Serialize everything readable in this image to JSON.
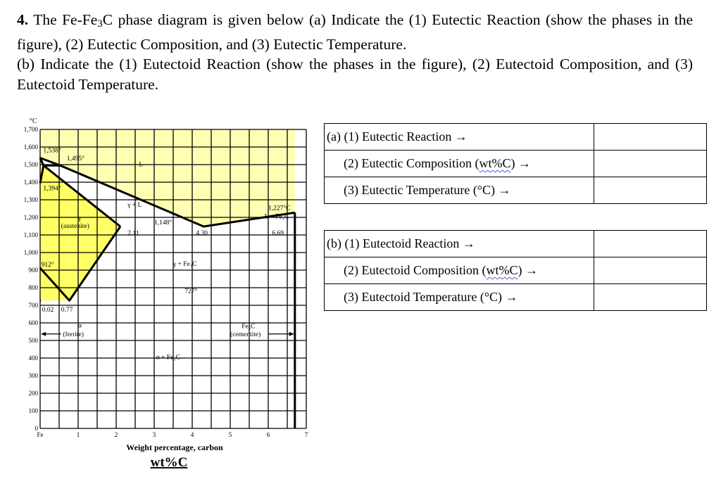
{
  "question": {
    "number": "4.",
    "part_a_text_1": " The Fe-Fe",
    "part_a_sub": "3",
    "part_a_text_2": "C phase diagram is given below (a) Indicate the (1) Eutectic Reaction (show the phases in the figure), (2) Eutectic Composition, and (3) Eutectic Temperature.",
    "part_b_text": "(b) Indicate the (1) Eutectoid Reaction (show the phases in the figure), (2) Eutectoid Composition, and (3) Eutectoid Temperature."
  },
  "table_a": {
    "rows": [
      {
        "label": "(a) (1) Eutectic Reaction →",
        "answer": ""
      },
      {
        "label_pre": "(2) Eutectic Composition (",
        "label_squig": "wt%C",
        "label_post": ") →",
        "answer": ""
      },
      {
        "label": "(3) Eutectic Temperature (°C) →",
        "answer": ""
      }
    ]
  },
  "table_b": {
    "rows": [
      {
        "label": "(b) (1) Eutectoid Reaction →",
        "answer": ""
      },
      {
        "label_pre": "(2) Eutectoid Composition (",
        "label_squig": "wt%C",
        "label_post": ") →",
        "answer": ""
      },
      {
        "label": "(3) Eutectoid Temperature (°C) →",
        "answer": ""
      }
    ]
  },
  "chart_data": {
    "type": "line",
    "title": "Fe-Fe3C phase diagram",
    "xlabel": "Weight percentage, carbon",
    "xlabel_units": "wt%C",
    "ylabel": "°C",
    "xlim": [
      0,
      7
    ],
    "ylim": [
      0,
      1700
    ],
    "grid": true,
    "x_ticks": [
      {
        "v": 0,
        "label": "Fe"
      },
      {
        "v": 1,
        "label": "1"
      },
      {
        "v": 2,
        "label": "2"
      },
      {
        "v": 3,
        "label": "3"
      },
      {
        "v": 4,
        "label": "4"
      },
      {
        "v": 5,
        "label": "5"
      },
      {
        "v": 6,
        "label": "6"
      },
      {
        "v": 7,
        "label": "7"
      }
    ],
    "y_ticks": [
      {
        "v": 0,
        "label": "0"
      },
      {
        "v": 100,
        "label": "100"
      },
      {
        "v": 200,
        "label": "200"
      },
      {
        "v": 300,
        "label": "300"
      },
      {
        "v": 400,
        "label": "400"
      },
      {
        "v": 500,
        "label": "500"
      },
      {
        "v": 600,
        "label": "600"
      },
      {
        "v": 700,
        "label": "700"
      },
      {
        "v": 800,
        "label": "800"
      },
      {
        "v": 900,
        "label": "900"
      },
      {
        "v": 1000,
        "label": "1,000"
      },
      {
        "v": 1100,
        "label": "1,100"
      },
      {
        "v": 1200,
        "label": "1,200"
      },
      {
        "v": 1300,
        "label": "1,300"
      },
      {
        "v": 1400,
        "label": "1,400"
      },
      {
        "v": 1500,
        "label": "1,500"
      },
      {
        "v": 1600,
        "label": "1,600"
      },
      {
        "v": 1700,
        "label": "1,700"
      }
    ],
    "colors": {
      "liquid_fill": "#ffffb3",
      "phase_fill": "#ffff66",
      "line": "#000000",
      "grid": "#000000"
    },
    "regions": [
      {
        "name": "liquid",
        "fill": "liquid_fill",
        "points": [
          [
            0,
            1700
          ],
          [
            6.7,
            1700
          ],
          [
            6.7,
            1227
          ],
          [
            4.3,
            1148
          ],
          [
            0.53,
            1495
          ],
          [
            0,
            1538
          ]
        ]
      },
      {
        "name": "austenite",
        "fill": "phase_fill",
        "points": [
          [
            0.09,
            1495
          ],
          [
            2.11,
            1148
          ],
          [
            0.77,
            727
          ],
          [
            0.02,
            727
          ],
          [
            0,
            912
          ],
          [
            0,
            1394
          ],
          [
            0.09,
            1495
          ]
        ]
      },
      {
        "name": "delta",
        "fill": "phase_fill",
        "points": [
          [
            0,
            1538
          ],
          [
            0.09,
            1495
          ],
          [
            0,
            1394
          ]
        ]
      }
    ],
    "lines": [
      {
        "name": "liquidus-left",
        "points": [
          [
            0,
            1538
          ],
          [
            0.53,
            1495
          ],
          [
            4.3,
            1148
          ]
        ]
      },
      {
        "name": "liquidus-right",
        "points": [
          [
            4.3,
            1148
          ],
          [
            6.7,
            1227
          ]
        ]
      },
      {
        "name": "solidus-austenite",
        "points": [
          [
            0.09,
            1495
          ],
          [
            2.11,
            1148
          ]
        ]
      },
      {
        "name": "acm-line",
        "points": [
          [
            2.11,
            1148
          ],
          [
            0.77,
            727
          ]
        ]
      },
      {
        "name": "a3-line",
        "points": [
          [
            0,
            912
          ],
          [
            0.77,
            727
          ]
        ]
      },
      {
        "name": "delta-boundary",
        "points": [
          [
            0,
            1538
          ],
          [
            0.09,
            1495
          ],
          [
            0,
            1394
          ]
        ]
      },
      {
        "name": "peritectic-line",
        "points": [
          [
            0.09,
            1495
          ],
          [
            0.53,
            1495
          ]
        ]
      },
      {
        "name": "cementite-line",
        "points": [
          [
            6.7,
            1227
          ],
          [
            6.7,
            0
          ]
        ]
      },
      {
        "name": "ferrite-solvus",
        "points": [
          [
            0,
            727
          ],
          [
            0.02,
            727
          ]
        ]
      }
    ],
    "annotations": [
      {
        "text": "1,538°",
        "x": 0.08,
        "y": 1570
      },
      {
        "text": "1,495°",
        "x": 0.7,
        "y": 1525
      },
      {
        "text": "1,394°",
        "x": 0.08,
        "y": 1355
      },
      {
        "text": "L",
        "x": 2.6,
        "y": 1490
      },
      {
        "text": "γ + L",
        "x": 2.3,
        "y": 1260
      },
      {
        "text": "1,227°C",
        "x": 6.0,
        "y": 1243
      },
      {
        "text": "L + Fe₃C",
        "x": 5.9,
        "y": 1195
      },
      {
        "text": "1,148°",
        "x": 3.0,
        "y": 1160
      },
      {
        "text": "γ",
        "x": 1.0,
        "y": 1185
      },
      {
        "text": "(austenite)",
        "x": 0.55,
        "y": 1140
      },
      {
        "text": "2.11",
        "x": 2.3,
        "y": 1100
      },
      {
        "text": "4.30",
        "x": 4.1,
        "y": 1100
      },
      {
        "text": "6.69",
        "x": 6.1,
        "y": 1100
      },
      {
        "text": "912°",
        "x": 0.03,
        "y": 920
      },
      {
        "text": "γ + Fe₃C",
        "x": 3.5,
        "y": 925
      },
      {
        "text": "727°",
        "x": 3.8,
        "y": 770
      },
      {
        "text": "0.02",
        "x": 0.05,
        "y": 665
      },
      {
        "text": "0.77",
        "x": 0.55,
        "y": 665
      },
      {
        "text": "α",
        "x": 1.0,
        "y": 575
      },
      {
        "text": "(ferrite)",
        "x": 0.6,
        "y": 525
      },
      {
        "text": "Fe₃C",
        "x": 5.3,
        "y": 570
      },
      {
        "text": "(cementite)",
        "x": 5.0,
        "y": 525
      },
      {
        "text": "α + Fe₃C",
        "x": 3.05,
        "y": 395
      }
    ],
    "markers": [
      {
        "name": "eutectic-point",
        "x": 4.3,
        "y": 1148
      },
      {
        "name": "eutectoid-point",
        "x": 0.77,
        "y": 727
      }
    ]
  }
}
